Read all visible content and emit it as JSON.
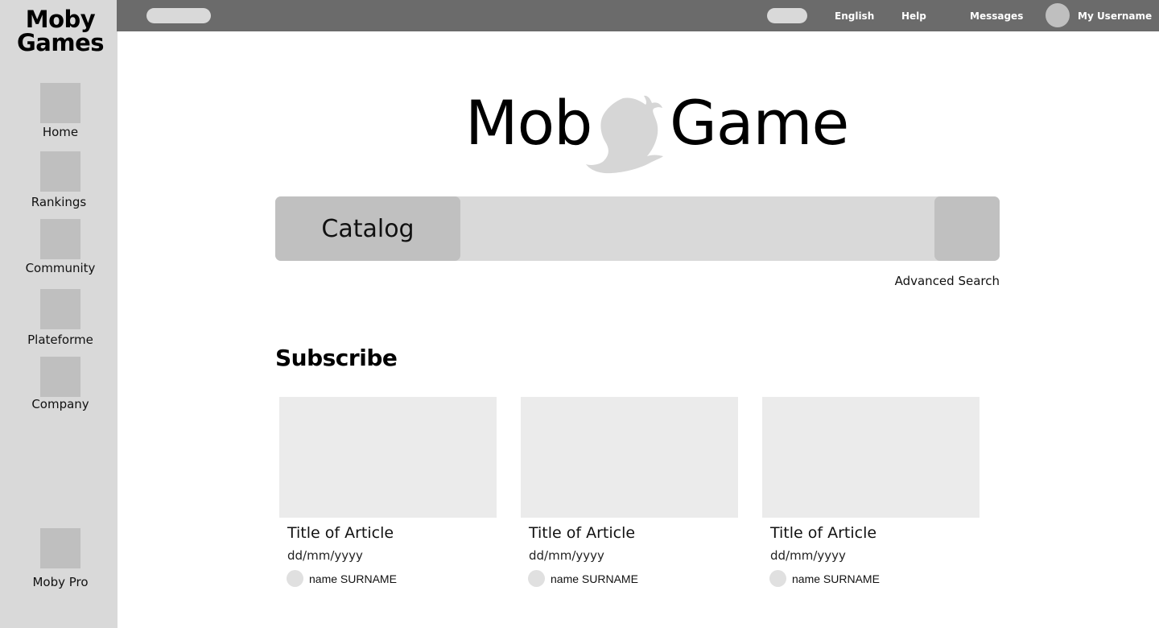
{
  "sidebar": {
    "brand_line1": "Moby",
    "brand_line2": "Games",
    "items": [
      {
        "label": "Home",
        "icon": "home-icon"
      },
      {
        "label": "Rankings",
        "icon": "rankings-icon"
      },
      {
        "label": "Community",
        "icon": "community-icon"
      },
      {
        "label": "Plateforme",
        "icon": "platform-icon"
      },
      {
        "label": "Company",
        "icon": "company-icon"
      }
    ],
    "pro": {
      "label": "Moby Pro",
      "icon": "moby-pro-icon"
    }
  },
  "topbar": {
    "language": "English",
    "help": "Help",
    "messages": "Messages",
    "username": "My Username"
  },
  "logo": {
    "left_text": "Mob",
    "right_text": "Game",
    "icon": "whale-logo-icon"
  },
  "search": {
    "category_label": "Catalog",
    "placeholder": "",
    "advanced_label": "Advanced Search"
  },
  "subscribe": {
    "title": "Subscribe",
    "articles": [
      {
        "title": "Title of Article",
        "date": "dd/mm/yyyy",
        "author": "name SURNAME"
      },
      {
        "title": "Title of Article",
        "date": "dd/mm/yyyy",
        "author": "name SURNAME"
      },
      {
        "title": "Title of Article",
        "date": "dd/mm/yyyy",
        "author": "name SURNAME"
      }
    ]
  },
  "colors": {
    "sidebar_bg": "#d9d9d9",
    "topbar_bg": "#6b6b6b",
    "placeholder_gray": "#bfbfbf",
    "card_bg": "#ebebeb"
  }
}
